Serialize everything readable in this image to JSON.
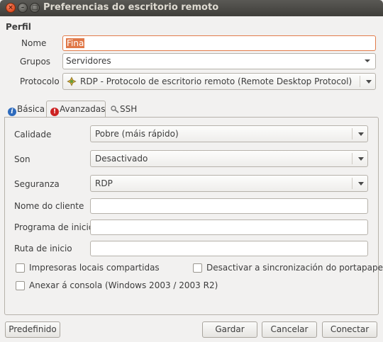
{
  "window": {
    "title": "Preferencias do escritorio remoto"
  },
  "profile": {
    "section_title": "Perfil",
    "name_label": "Nome",
    "name_value": "Fina",
    "groups_label": "Grupos",
    "groups_value": "Servidores",
    "protocol_label": "Protocolo",
    "protocol_value": "RDP - Protocolo de escritorio remoto (Remote Desktop Protocol)"
  },
  "tabs": [
    {
      "label": "Básica",
      "icon": "info-icon"
    },
    {
      "label": "Avanzadas",
      "icon": "warning-icon",
      "active": true
    },
    {
      "label": "SSH",
      "icon": "key-icon"
    }
  ],
  "advanced": {
    "quality_label": "Calidade",
    "quality_value": "Pobre (máis rápido)",
    "sound_label": "Son",
    "sound_value": "Desactivado",
    "security_label": "Seguranza",
    "security_value": "RDP",
    "client_name_label": "Nome do cliente",
    "client_name_value": "",
    "startup_program_label": "Programa de inicio",
    "startup_program_value": "",
    "startup_path_label": "Ruta de inicio",
    "startup_path_value": "",
    "shared_printers_label": "Impresoras locais compartidas",
    "shared_printers_checked": false,
    "disable_wallpaper_sync_label": "Desactivar a sincronización do portapapeis",
    "disable_wallpaper_sync_checked": false,
    "attach_console_label": "Anexar á consola (Windows 2003 / 2003 R2)",
    "attach_console_checked": false
  },
  "buttons": {
    "default": "Predefinido",
    "save": "Gardar",
    "cancel": "Cancelar",
    "connect": "Conectar"
  }
}
